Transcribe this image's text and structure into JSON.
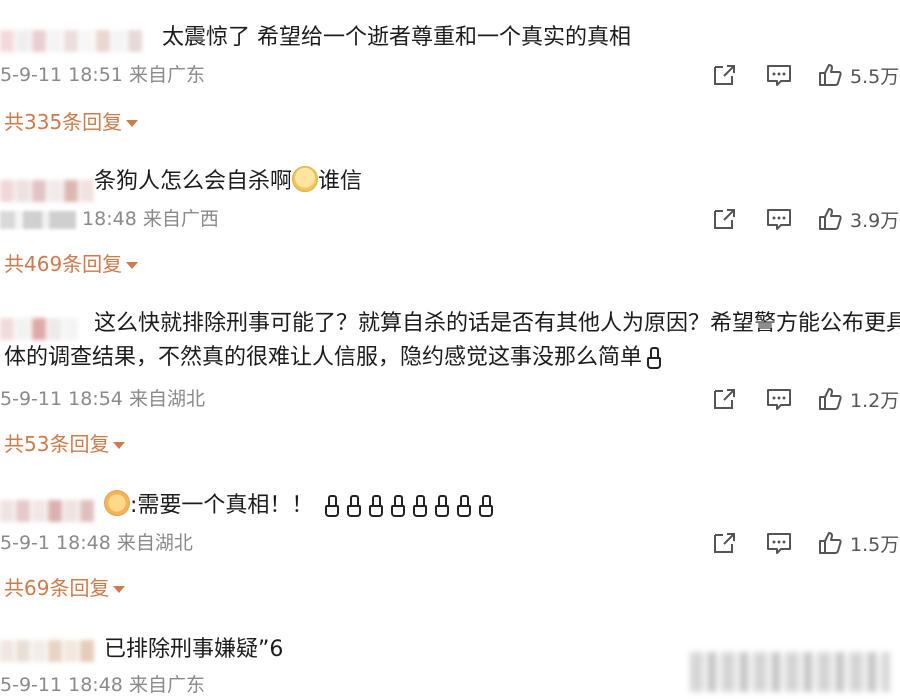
{
  "comments": [
    {
      "text": "太震惊了 希望给一个逝者尊重和一个真实的真相",
      "date": "5-9-11",
      "time": "18:51",
      "location": "来自广东",
      "likes": "5.5万",
      "replies": "共335条回复"
    },
    {
      "text_a": "条狗人怎么会自杀啊",
      "text_b": "谁信",
      "time": "18:48",
      "location": "来自广西",
      "likes": "3.9万",
      "replies": "共469条回复"
    },
    {
      "line1": "这么快就排除刑事可能了？就算自杀的话是否有其他人为原因？希望警方能公布更具",
      "line2": "体的调查结果，不然真的很难让人信服，隐约感觉这事没那么简单",
      "date": "5-9-11",
      "time": "18:54",
      "location": "来自湖北",
      "likes": "1.2万",
      "replies": "共53条回复"
    },
    {
      "text": ":需要一个真相！！",
      "date": "5-9-1",
      "time": "18:48",
      "location": "来自湖北",
      "likes": "1.5万",
      "replies": "共69条回复"
    },
    {
      "text": "已排除刑事嫌疑”6",
      "date": "5-9-11",
      "time": "18:48",
      "location": "来自广东"
    }
  ],
  "icons": {
    "share": "share-icon",
    "comment": "comment-icon",
    "like": "thumbs-up-icon",
    "sad_emoji": "crying-face-emoji",
    "folded_hands": "prayer-hands-emoji"
  },
  "colors": {
    "reply_link": "#cf7a4a",
    "meta_text": "#8a8a8a"
  }
}
